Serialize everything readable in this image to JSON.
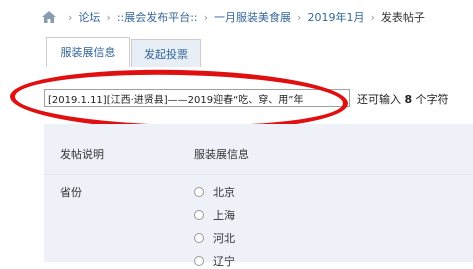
{
  "breadcrumb": {
    "items": [
      "论坛",
      "::展会发布平台::",
      "一月服装美食展",
      "2019年1月"
    ],
    "current": "发表帖子",
    "separator": "›"
  },
  "tabs": [
    {
      "label": "服装展信息",
      "active": true
    },
    {
      "label": "发起投票",
      "active": false
    }
  ],
  "subject": {
    "value": "[2019.1.11][江西·进贤县]——2019迎春“吃、穿、用”年",
    "remain_prefix": "还可输入",
    "remain_count": "8",
    "remain_suffix": "个字符"
  },
  "form": {
    "desc_label": "发帖说明",
    "desc_value": "服装展信息",
    "province_label": "省份",
    "provinces": [
      "北京",
      "上海",
      "河北",
      "辽宁"
    ]
  },
  "colors": {
    "annotation": "#e01010",
    "link": "#336699",
    "form_bg": "#eef2f8"
  }
}
